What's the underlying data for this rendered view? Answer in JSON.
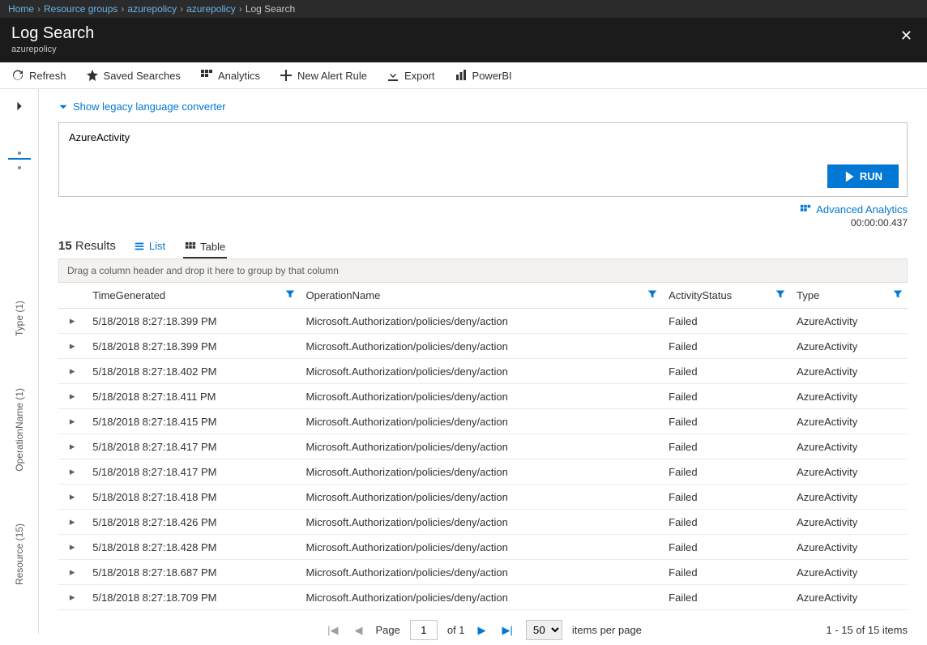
{
  "breadcrumb": {
    "items": [
      "Home",
      "Resource groups",
      "azurepolicy",
      "azurepolicy"
    ],
    "current": "Log Search"
  },
  "header": {
    "title": "Log Search",
    "subtitle": "azurepolicy"
  },
  "toolbar": {
    "refresh": "Refresh",
    "saved": "Saved Searches",
    "analytics": "Analytics",
    "newalert": "New Alert Rule",
    "export": "Export",
    "powerbi": "PowerBI"
  },
  "sidebar": {
    "facets": [
      "Type (1)",
      "OperationName (1)",
      "Resource (15)"
    ]
  },
  "content": {
    "legacy_link": "Show legacy language converter",
    "query": "AzureActivity",
    "run_label": "RUN",
    "advanced_link": "Advanced Analytics",
    "elapsed": "00:00:00.437",
    "results_count": "15",
    "results_label": "Results",
    "view_list": "List",
    "view_table": "Table",
    "group_hint": "Drag a column header and drop it here to group by that column"
  },
  "table": {
    "columns": [
      "TimeGenerated",
      "OperationName",
      "ActivityStatus",
      "Type"
    ],
    "rows": [
      {
        "t": "5/18/2018 8:27:18.399 PM",
        "op": "Microsoft.Authorization/policies/deny/action",
        "st": "Failed",
        "ty": "AzureActivity"
      },
      {
        "t": "5/18/2018 8:27:18.399 PM",
        "op": "Microsoft.Authorization/policies/deny/action",
        "st": "Failed",
        "ty": "AzureActivity"
      },
      {
        "t": "5/18/2018 8:27:18.402 PM",
        "op": "Microsoft.Authorization/policies/deny/action",
        "st": "Failed",
        "ty": "AzureActivity"
      },
      {
        "t": "5/18/2018 8:27:18.411 PM",
        "op": "Microsoft.Authorization/policies/deny/action",
        "st": "Failed",
        "ty": "AzureActivity"
      },
      {
        "t": "5/18/2018 8:27:18.415 PM",
        "op": "Microsoft.Authorization/policies/deny/action",
        "st": "Failed",
        "ty": "AzureActivity"
      },
      {
        "t": "5/18/2018 8:27:18.417 PM",
        "op": "Microsoft.Authorization/policies/deny/action",
        "st": "Failed",
        "ty": "AzureActivity"
      },
      {
        "t": "5/18/2018 8:27:18.417 PM",
        "op": "Microsoft.Authorization/policies/deny/action",
        "st": "Failed",
        "ty": "AzureActivity"
      },
      {
        "t": "5/18/2018 8:27:18.418 PM",
        "op": "Microsoft.Authorization/policies/deny/action",
        "st": "Failed",
        "ty": "AzureActivity"
      },
      {
        "t": "5/18/2018 8:27:18.426 PM",
        "op": "Microsoft.Authorization/policies/deny/action",
        "st": "Failed",
        "ty": "AzureActivity"
      },
      {
        "t": "5/18/2018 8:27:18.428 PM",
        "op": "Microsoft.Authorization/policies/deny/action",
        "st": "Failed",
        "ty": "AzureActivity"
      },
      {
        "t": "5/18/2018 8:27:18.687 PM",
        "op": "Microsoft.Authorization/policies/deny/action",
        "st": "Failed",
        "ty": "AzureActivity"
      },
      {
        "t": "5/18/2018 8:27:18.709 PM",
        "op": "Microsoft.Authorization/policies/deny/action",
        "st": "Failed",
        "ty": "AzureActivity"
      }
    ]
  },
  "pager": {
    "page_label": "Page",
    "page": "1",
    "of_label": "of 1",
    "size": "50",
    "per_page": "items per page",
    "summary": "1 - 15 of 15 items"
  }
}
